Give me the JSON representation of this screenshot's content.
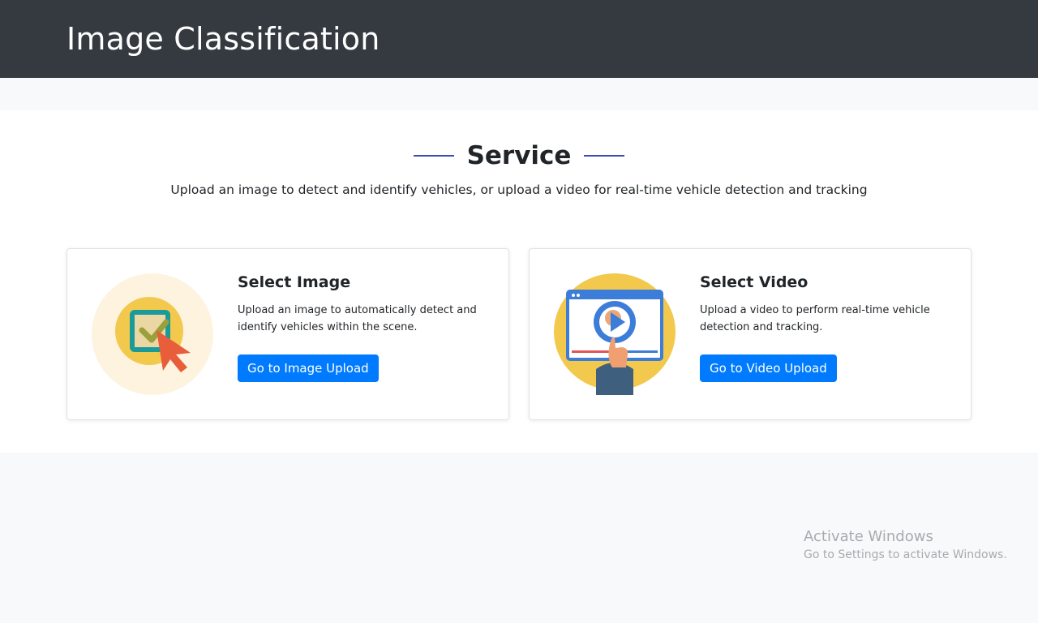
{
  "header": {
    "title": "Image Classification"
  },
  "service": {
    "title": "Service",
    "subtitle": "Upload an image to detect and identify vehicles, or upload a video for real-time vehicle detection and tracking"
  },
  "cards": [
    {
      "title": "Select Image",
      "description": "Upload an image to automatically detect and identify vehicles within the scene.",
      "button_label": "Go to Image Upload",
      "icon": "image-select-illustration"
    },
    {
      "title": "Select Video",
      "description": "Upload a video to perform real-time vehicle detection and tracking.",
      "button_label": "Go to Video Upload",
      "icon": "video-play-illustration"
    }
  ],
  "watermark": {
    "title": "Activate Windows",
    "subtitle": "Go to Settings to activate Windows."
  },
  "colors": {
    "header_bg": "#343a40",
    "accent_line": "#3c4bb5",
    "button": "#007bff",
    "illustration_yellow": "#f2c94c"
  }
}
